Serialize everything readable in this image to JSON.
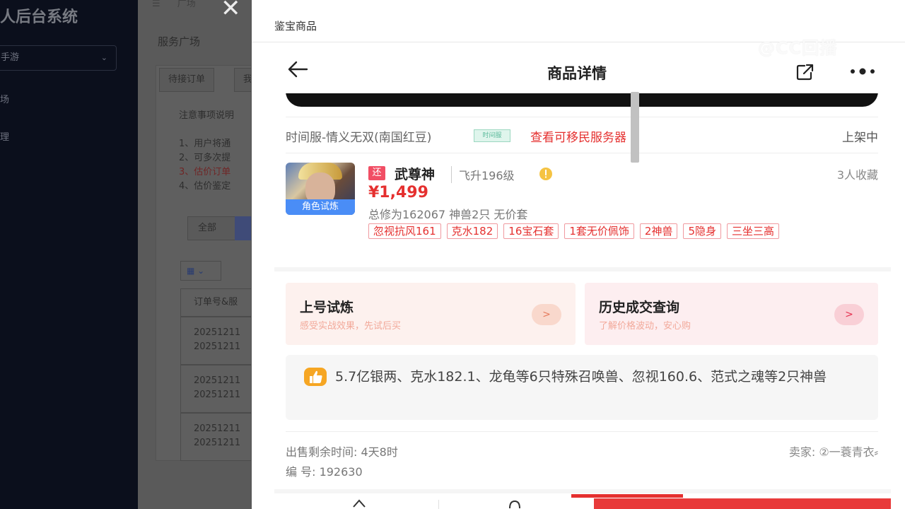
{
  "background": {
    "brand": "人后台系统",
    "select_value": "手游",
    "side_items": [
      "场",
      "理"
    ],
    "breadcrumb": "广场",
    "page_title": "服务广场",
    "tabs": [
      "待接订单",
      "我"
    ],
    "notice_title": "注意事项说明",
    "notice_lines": [
      "1、用户将通",
      "2、可多次提",
      "3、估价订单",
      "4、估价鉴定"
    ],
    "filter_all": "全部",
    "grid_icon": "grid-icon",
    "table_header": "订单号&服",
    "order_rows": [
      [
        "20251211",
        "20251211"
      ],
      [
        "20251211",
        "20251211"
      ],
      [
        "20251211",
        "20251211"
      ]
    ]
  },
  "drawer": {
    "title": "鉴宝商品",
    "watermark": "@CC回播",
    "nav": {
      "title": "商品详情",
      "back_icon": "arrow-left-icon",
      "share_icon": "share-icon",
      "more_icon": "more-icon"
    },
    "server": {
      "name": "时间服-情义无双(南国红豆)",
      "tag": "时间服",
      "migrate_link": "查看可移民服务器 >",
      "status": "上架中"
    },
    "product": {
      "badge": "角色试炼",
      "tag": "还",
      "name": "武尊神",
      "level": "飞升196级",
      "favorites": "3人收藏",
      "price": "¥1,499",
      "summary": "总修为162067  神兽2只  无价套",
      "chips": [
        "忽视抗风161",
        "克水182",
        "16宝石套",
        "1套无价佩饰",
        "2神兽",
        "5隐身",
        "三坐三高"
      ]
    },
    "cards": [
      {
        "title": "上号试炼",
        "subtitle": "感受实战效果，先试后买",
        "arrow": ">"
      },
      {
        "title": "历史成交查询",
        "subtitle": "了解价格波动，安心购",
        "arrow": ">"
      }
    ],
    "highlight": "5.7亿银两、克水182.1、龙龟等6只特殊召唤兽、忽视160.6、范式之魂等2只神兽",
    "meta": {
      "remain": "出售剩余时间: 4天8时",
      "seller": "卖家: ②一蓑青衣⸗",
      "code": "编  号: 192630"
    },
    "colors": {
      "accent": "#e5302f",
      "badge_blue": "#4a8df6",
      "card_left_bg": "#fdf1ee",
      "card_right_bg": "#fdeef0"
    }
  }
}
